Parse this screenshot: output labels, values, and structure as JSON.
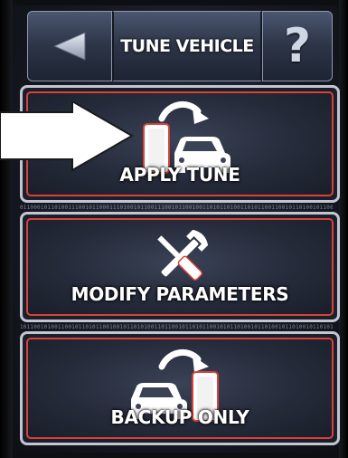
{
  "header": {
    "back_icon": "back-triangle-icon",
    "title": "TUNE VEHICLE",
    "help_icon": "help-question-icon",
    "help_glyph": "?"
  },
  "menu": {
    "items": [
      {
        "label": "APPLY TUNE",
        "icon": "phone-to-car-icon"
      },
      {
        "label": "MODIFY PARAMETERS",
        "icon": "wrench-screwdriver-icon"
      },
      {
        "label": "BACKUP ONLY",
        "icon": "car-to-phone-icon"
      }
    ]
  },
  "colors": {
    "accent_red": "#d9413a",
    "panel_border": "#c2c6d0",
    "header_bg": "#2c3446",
    "text": "#ffffff"
  }
}
